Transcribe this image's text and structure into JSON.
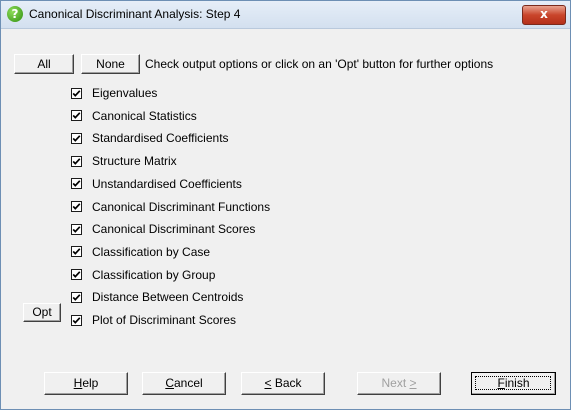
{
  "window": {
    "title": "Canonical Discriminant Analysis: Step 4",
    "close_label": "x"
  },
  "top_buttons": {
    "all_label": "All",
    "none_label": "None",
    "hint": "Check output options or click on an 'Opt' button for further options"
  },
  "options": [
    {
      "label": "Eigenvalues",
      "checked": true
    },
    {
      "label": "Canonical Statistics",
      "checked": true
    },
    {
      "label": "Standardised Coefficients",
      "checked": true
    },
    {
      "label": "Structure Matrix",
      "checked": true
    },
    {
      "label": "Unstandardised Coefficients",
      "checked": true
    },
    {
      "label": "Canonical Discriminant Functions",
      "checked": true
    },
    {
      "label": "Canonical Discriminant Scores",
      "checked": true
    },
    {
      "label": "Classification by Case",
      "checked": true
    },
    {
      "label": "Classification by Group",
      "checked": true
    },
    {
      "label": "Distance Between Centroids",
      "checked": true
    },
    {
      "label": "Plot of Discriminant Scores",
      "checked": true
    }
  ],
  "opt_button": {
    "label": "Opt"
  },
  "footer": {
    "help": {
      "pre": "",
      "mn": "H",
      "post": "elp"
    },
    "cancel": {
      "pre": "",
      "mn": "C",
      "post": "ancel"
    },
    "back": {
      "pre": "",
      "mn": "<",
      "post": " Back"
    },
    "next": {
      "pre": "Next ",
      "mn": ">",
      "post": ""
    },
    "finish": {
      "pre": "",
      "mn": "F",
      "post": "inish"
    }
  }
}
